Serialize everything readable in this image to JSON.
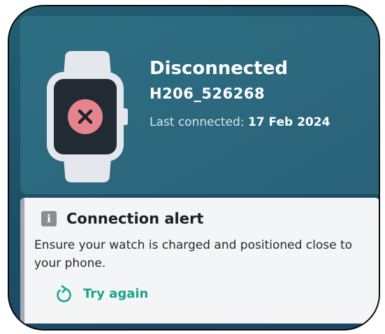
{
  "device": {
    "status": "Disconnected",
    "id": "H206_526268",
    "last_connected_label": "Last connected: ",
    "last_connected_date": "17 Feb 2024",
    "watch_icon": "smartwatch-icon",
    "status_icon": "close-icon"
  },
  "alert": {
    "icon": "info-icon",
    "icon_glyph": "i",
    "title": "Connection alert",
    "message": "Ensure your watch is charged and positioned close to your phone.",
    "action_icon": "refresh-icon",
    "action_label": "Try again"
  },
  "colors": {
    "accent": "#1aa38a",
    "error": "#e6848c",
    "panel": "#2c6a80"
  }
}
